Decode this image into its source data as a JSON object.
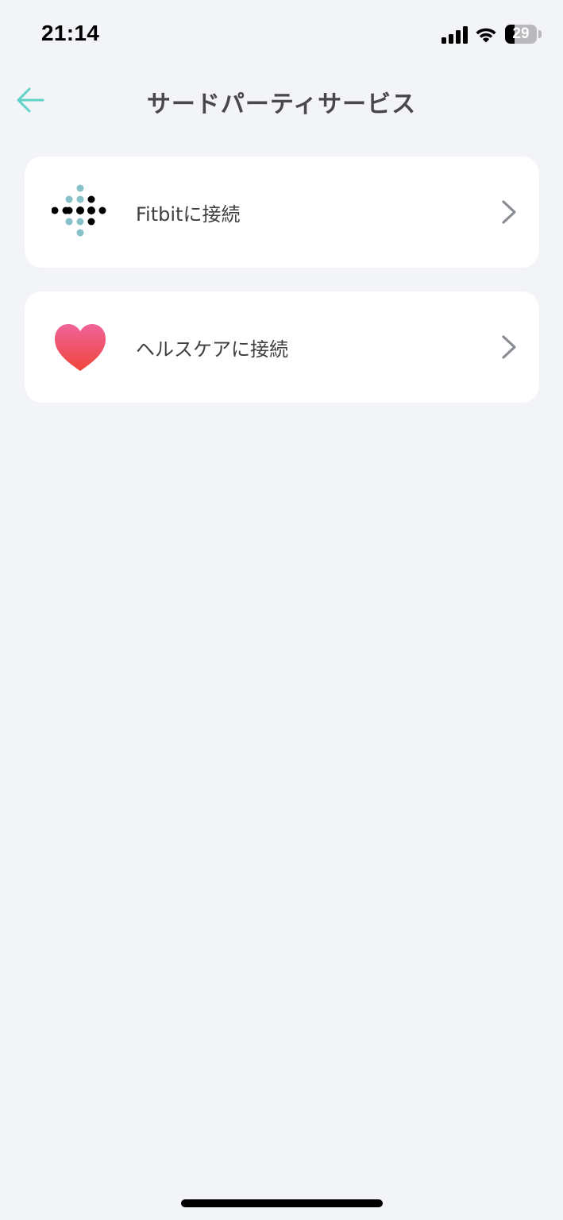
{
  "status_bar": {
    "time": "21:14",
    "battery_level": "29",
    "battery_fraction": 0.29
  },
  "header": {
    "title": "サードパーティサービス",
    "back_icon": "arrow-left-icon",
    "back_color": "#5fd3c8"
  },
  "services": [
    {
      "label": "Fitbitに接続",
      "icon": "fitbit-logo-icon"
    },
    {
      "label": "ヘルスケアに接続",
      "icon": "heart-icon"
    }
  ],
  "colors": {
    "background": "#f3f4f8",
    "card": "#ffffff",
    "chevron": "#8a8c94",
    "fitbit_teal": "#86c0c9",
    "fitbit_black": "#000000",
    "heart_top": "#f0649a",
    "heart_bottom": "#f0453a"
  }
}
